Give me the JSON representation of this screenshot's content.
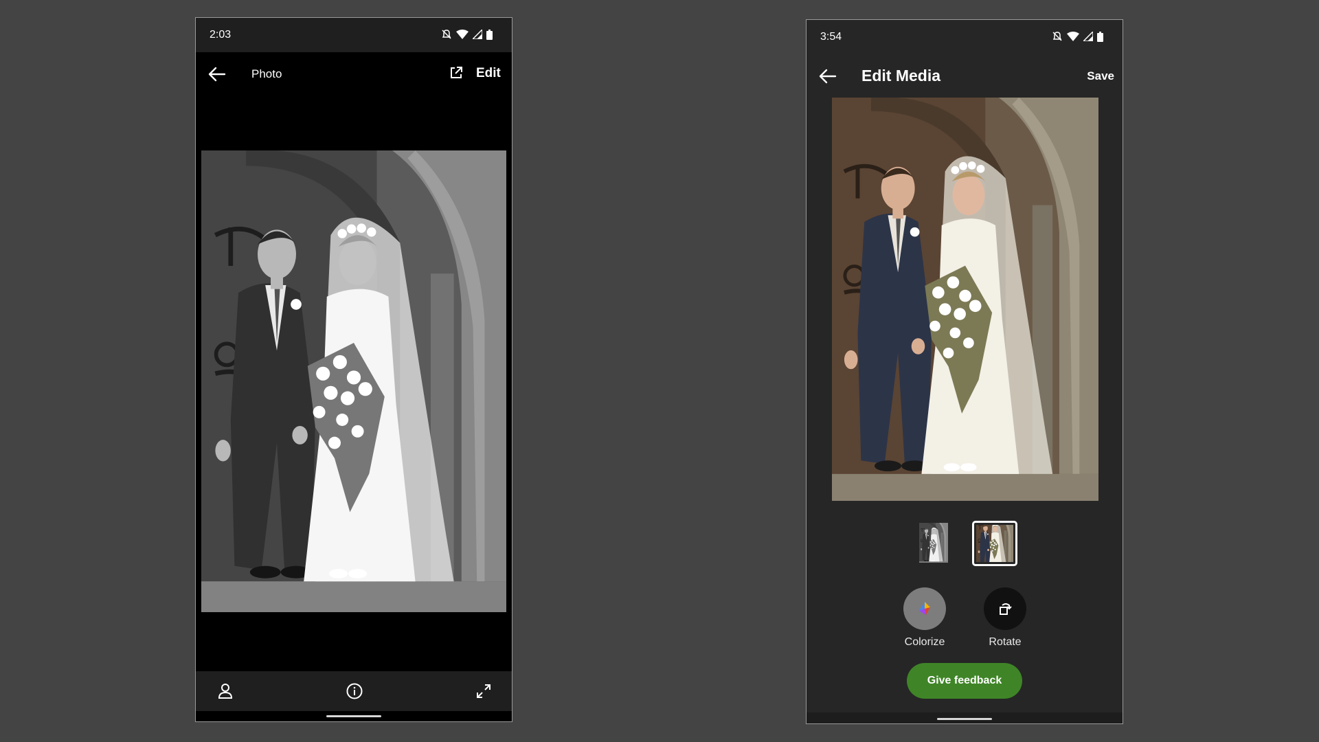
{
  "colors": {
    "background": "#444444",
    "feedback_button": "#3f8527"
  },
  "left_screen": {
    "status_time": "2:03",
    "title": "Photo",
    "edit_label": "Edit",
    "icons": [
      "back-arrow-icon",
      "open-external-icon",
      "person-icon",
      "info-icon",
      "expand-icon"
    ]
  },
  "right_screen": {
    "status_time": "3:54",
    "title": "Edit Media",
    "save_label": "Save",
    "tools": [
      {
        "label": "Colorize",
        "icon": "colorize-icon"
      },
      {
        "label": "Rotate",
        "icon": "rotate-icon"
      }
    ],
    "feedback_label": "Give feedback",
    "thumbnails": [
      "original",
      "colorized"
    ],
    "selected_thumbnail": "colorized"
  }
}
